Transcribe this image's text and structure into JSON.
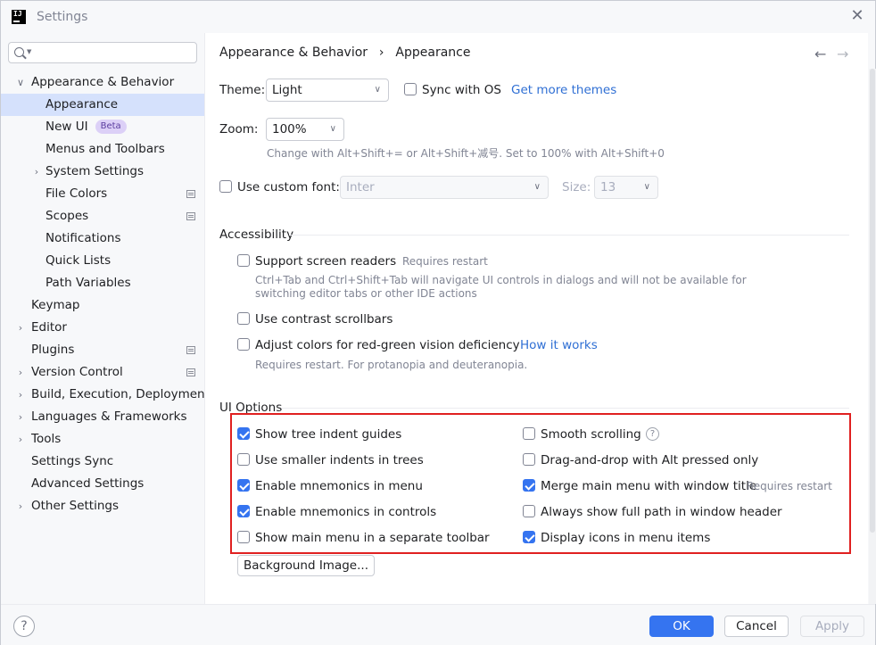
{
  "window": {
    "title": "Settings",
    "app_icon_text": "IJ"
  },
  "search": {
    "value": "",
    "placeholder": ""
  },
  "sidebar": {
    "items": [
      {
        "label": "Appearance & Behavior",
        "expanded": true
      },
      {
        "label": "Appearance",
        "selected": true
      },
      {
        "label": "New UI",
        "badge": "Beta"
      },
      {
        "label": "Menus and Toolbars"
      },
      {
        "label": "System Settings",
        "expandable": true
      },
      {
        "label": "File Colors",
        "project_icon": true
      },
      {
        "label": "Scopes",
        "project_icon": true
      },
      {
        "label": "Notifications"
      },
      {
        "label": "Quick Lists"
      },
      {
        "label": "Path Variables"
      },
      {
        "label": "Keymap"
      },
      {
        "label": "Editor",
        "expandable": true
      },
      {
        "label": "Plugins",
        "project_icon": true
      },
      {
        "label": "Version Control",
        "expandable": true,
        "project_icon": true
      },
      {
        "label": "Build, Execution, Deployment",
        "expandable": true
      },
      {
        "label": "Languages & Frameworks",
        "expandable": true
      },
      {
        "label": "Tools",
        "expandable": true
      },
      {
        "label": "Settings Sync"
      },
      {
        "label": "Advanced Settings"
      },
      {
        "label": "Other Settings",
        "expandable": true
      }
    ]
  },
  "breadcrumb": {
    "parent": "Appearance & Behavior",
    "separator": "›",
    "current": "Appearance"
  },
  "nav": {
    "back": "←",
    "forward": "→"
  },
  "theme": {
    "label": "Theme:",
    "value": "Light",
    "sync_label": "Sync with OS",
    "sync_checked": false,
    "more_link": "Get more themes"
  },
  "zoom": {
    "label": "Zoom:",
    "value": "100%",
    "hint": "Change with Alt+Shift+= or Alt+Shift+减号. Set to 100% with Alt+Shift+0"
  },
  "custom_font": {
    "label": "Use custom font:",
    "checked": false,
    "font_value": "Inter",
    "size_label": "Size:",
    "size_value": "13"
  },
  "accessibility": {
    "title": "Accessibility",
    "screen_readers": {
      "label": "Support screen readers",
      "checked": false,
      "note": "Requires restart",
      "hint_line1": "Ctrl+Tab and Ctrl+Shift+Tab will navigate UI controls in dialogs and will not be available for",
      "hint_line2": "switching editor tabs or other IDE actions"
    },
    "contrast_scrollbars": {
      "label": "Use contrast scrollbars",
      "checked": false
    },
    "color_deficiency": {
      "label": "Adjust colors for red-green vision deficiency",
      "checked": false,
      "link": "How it works",
      "hint": "Requires restart. For protanopia and deuteranopia."
    }
  },
  "ui_options": {
    "title": "UI Options",
    "left": [
      {
        "label": "Show tree indent guides",
        "checked": true
      },
      {
        "label": "Use smaller indents in trees",
        "checked": false
      },
      {
        "label": "Enable mnemonics in menu",
        "checked": true
      },
      {
        "label": "Enable mnemonics in controls",
        "checked": true
      },
      {
        "label": "Show main menu in a separate toolbar",
        "checked": false
      }
    ],
    "right": [
      {
        "label": "Smooth scrolling",
        "checked": false,
        "help": "?"
      },
      {
        "label": "Drag-and-drop with Alt pressed only",
        "checked": false
      },
      {
        "label": "Merge main menu with window title",
        "checked": true,
        "note": "Requires restart"
      },
      {
        "label": "Always show full path in window header",
        "checked": false
      },
      {
        "label": "Display icons in menu items",
        "checked": true
      }
    ],
    "background_button": "Background Image..."
  },
  "footer": {
    "help": "?",
    "ok": "OK",
    "cancel": "Cancel",
    "apply": "Apply"
  },
  "colors": {
    "accent": "#3574f0",
    "selection": "#d5e1fc",
    "link": "#2f6fd4",
    "highlight_box": "#e02020"
  }
}
